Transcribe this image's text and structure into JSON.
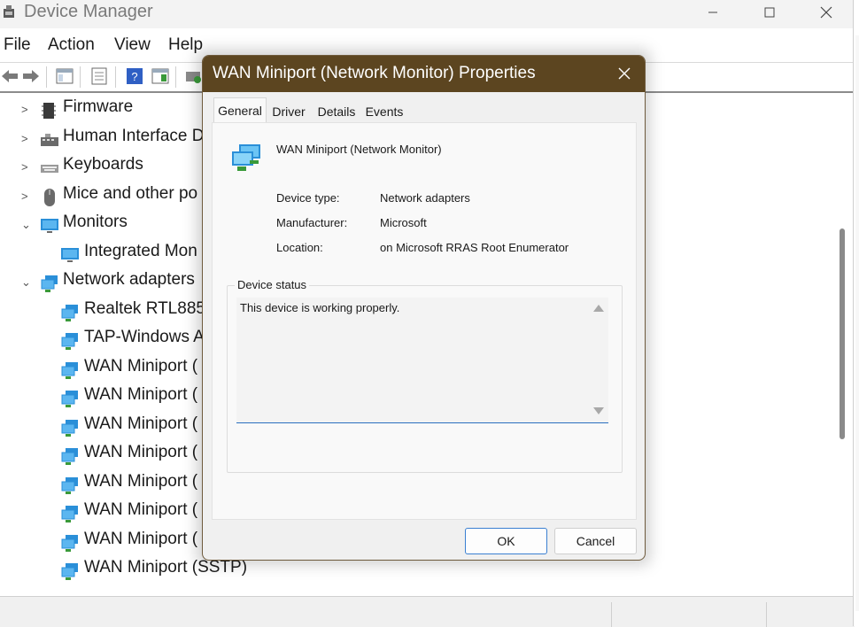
{
  "window": {
    "title": "Device Manager"
  },
  "menu": {
    "items": [
      "File",
      "Action",
      "View",
      "Help"
    ]
  },
  "tree": {
    "rows": [
      {
        "label": "Firmware",
        "icon": "firmware-icon",
        "expand": "collapsed"
      },
      {
        "label": "Human Interface D",
        "icon": "hid-icon",
        "expand": "collapsed"
      },
      {
        "label": "Keyboards",
        "icon": "keyboard-icon",
        "expand": "collapsed"
      },
      {
        "label": "Mice and other po",
        "icon": "mouse-icon",
        "expand": "collapsed"
      },
      {
        "label": "Monitors",
        "icon": "monitor-icon",
        "expand": "expanded"
      },
      {
        "label": "Integrated Mon",
        "icon": "monitor-icon",
        "expand": "none"
      },
      {
        "label": "Network adapters",
        "icon": "network-adapter-icon",
        "expand": "expanded"
      },
      {
        "label": "Realtek RTL8852",
        "icon": "network-adapter-icon",
        "expand": "none"
      },
      {
        "label": "TAP-Windows A",
        "icon": "network-adapter-icon",
        "expand": "none"
      },
      {
        "label": "WAN Miniport (",
        "icon": "network-adapter-icon",
        "expand": "none"
      },
      {
        "label": "WAN Miniport (",
        "icon": "network-adapter-icon",
        "expand": "none"
      },
      {
        "label": "WAN Miniport (",
        "icon": "network-adapter-icon",
        "expand": "none"
      },
      {
        "label": "WAN Miniport (",
        "icon": "network-adapter-icon",
        "expand": "none"
      },
      {
        "label": "WAN Miniport (",
        "icon": "network-adapter-icon",
        "expand": "none"
      },
      {
        "label": "WAN Miniport (",
        "icon": "network-adapter-icon",
        "expand": "none"
      },
      {
        "label": "WAN Miniport (",
        "icon": "network-adapter-icon",
        "expand": "none"
      },
      {
        "label": "WAN Miniport (SSTP)",
        "icon": "network-adapter-icon",
        "expand": "none"
      }
    ]
  },
  "dialog": {
    "title": "WAN Miniport (Network Monitor) Properties",
    "close_label": "✕",
    "tabs": [
      "General",
      "Driver",
      "Details",
      "Events"
    ],
    "active_tab": "General",
    "device_name": "WAN Miniport (Network Monitor)",
    "properties": [
      {
        "label": "Device type:",
        "value": "Network adapters"
      },
      {
        "label": "Manufacturer:",
        "value": "Microsoft"
      },
      {
        "label": "Location:",
        "value": "on Microsoft RRAS Root Enumerator"
      }
    ],
    "status_group_label": "Device status",
    "status_text": "This device is working properly.",
    "ok_label": "OK",
    "cancel_label": "Cancel"
  },
  "colors": {
    "dialog_titlebar": "#5c4520",
    "accent": "#2b6fbf",
    "network_icon_blue": "#2a8fd8",
    "network_icon_green": "#3a9a3a"
  }
}
